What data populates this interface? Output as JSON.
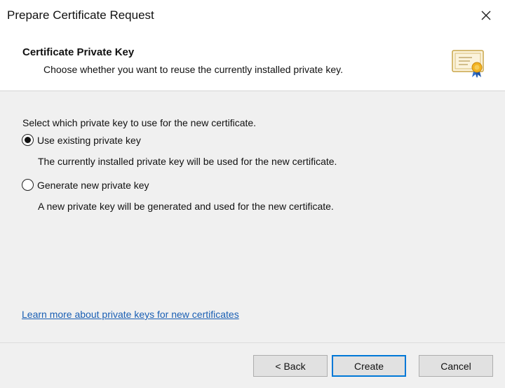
{
  "window": {
    "title": "Prepare Certificate Request",
    "close_icon": "close-icon"
  },
  "header": {
    "heading": "Certificate Private Key",
    "subheading": "Choose whether you want to reuse the currently installed private key.",
    "icon": "certificate-icon"
  },
  "body": {
    "prompt": "Select which private key to use for the new certificate.",
    "options": [
      {
        "label": "Use existing private key",
        "description": "The currently installed private key will be used for the new certificate.",
        "selected": true
      },
      {
        "label": "Generate new private key",
        "description": "A new private key will be generated and used for the new certificate.",
        "selected": false
      }
    ],
    "learn_more_link": "Learn more about private keys for new certificates"
  },
  "footer": {
    "back_label": "< Back",
    "create_label": "Create",
    "cancel_label": "Cancel"
  },
  "colors": {
    "link": "#1a5fb4",
    "default_button_border": "#0078d7",
    "body_background": "#f0f0f0"
  }
}
